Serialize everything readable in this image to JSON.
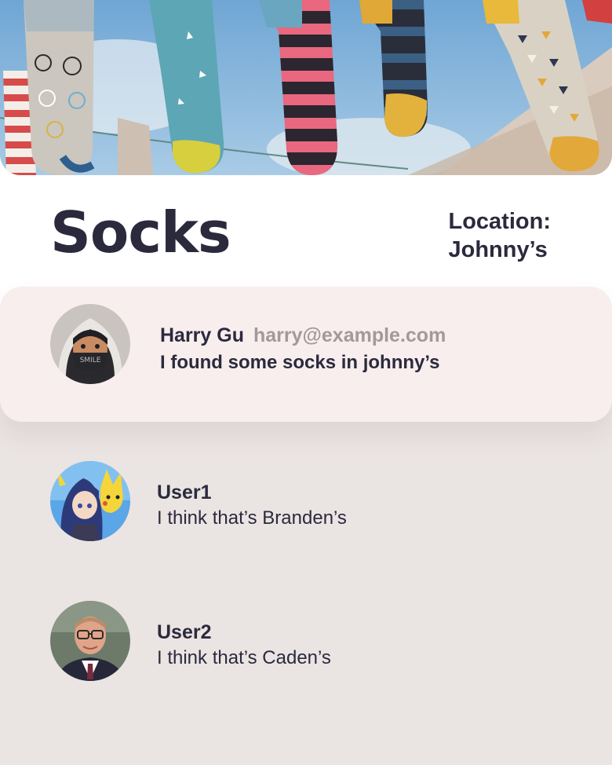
{
  "post": {
    "title": "Socks",
    "location_label": "Location:",
    "location_value": "Johnny’s"
  },
  "comments": [
    {
      "name": "Harry Gu",
      "email": "harry@example.com",
      "text": "I found some socks in johnny’s",
      "avatar": "hooded-avatar-smile-mask"
    },
    {
      "name": "User1",
      "text": "I think that’s Branden’s",
      "avatar": "anime-character-avatar"
    },
    {
      "name": "User2",
      "text": "I think that’s Caden’s",
      "avatar": "man-with-glasses-avatar"
    }
  ],
  "colors": {
    "page_background": "#eae4e3",
    "header_background": "#ffffff",
    "featured_comment_background": "#f8eeee",
    "text_dark": "#2b2a3d",
    "email_gray": "#a3989a"
  },
  "hero_image": {
    "avatar_mask_text": "SMILE"
  }
}
